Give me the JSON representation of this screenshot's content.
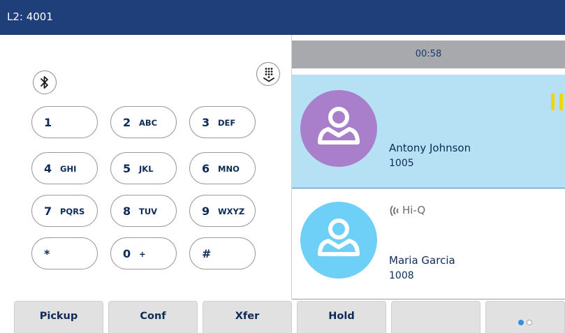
{
  "header": {
    "title": "L2: 4001"
  },
  "dialpad": {
    "bluetooth_icon": "bluetooth-icon",
    "keypad_icon": "keypad-collapse-icon",
    "keys": [
      {
        "digit": "1",
        "letters": ""
      },
      {
        "digit": "2",
        "letters": "ABC"
      },
      {
        "digit": "3",
        "letters": "DEF"
      },
      {
        "digit": "4",
        "letters": "GHI"
      },
      {
        "digit": "5",
        "letters": "JKL"
      },
      {
        "digit": "6",
        "letters": "MNO"
      },
      {
        "digit": "7",
        "letters": "PQRS"
      },
      {
        "digit": "8",
        "letters": "TUV"
      },
      {
        "digit": "9",
        "letters": "WXYZ"
      },
      {
        "digit": "*",
        "letters": ""
      },
      {
        "digit": "0",
        "letters": "+"
      },
      {
        "digit": "#",
        "letters": ""
      }
    ]
  },
  "calls": {
    "timer": "00:58",
    "list": [
      {
        "name": "Antony Johnson",
        "number": "1005",
        "status_icon": "hold-icon",
        "avatar_icon": "contact-avatar-icon",
        "avatar_color": "#a97fcb",
        "highlight_color": "#b6e1f5"
      },
      {
        "name": "Maria Garcia",
        "number": "1008",
        "badge": "Hi-Q",
        "badge_icon": "hiq-audio-icon",
        "avatar_icon": "contact-avatar-icon",
        "avatar_color": "#6ed0f6"
      }
    ]
  },
  "softkeys": [
    {
      "label": "Pickup"
    },
    {
      "label": "Conf"
    },
    {
      "label": "Xfer"
    },
    {
      "label": "Hold"
    },
    {
      "label": ""
    },
    {
      "label": "",
      "page_indicator": {
        "pages": 2,
        "current": 1
      }
    }
  ],
  "colors": {
    "header_bg": "#1f3f7a",
    "timer_bar_bg": "#a7a9ac",
    "active_call_bg": "#b6e1f5",
    "hold_indicator": "#f5d400",
    "softkey_bg": "#e1e1e1",
    "page_dot_active": "#2f92e0",
    "text": "#0d2b57"
  }
}
